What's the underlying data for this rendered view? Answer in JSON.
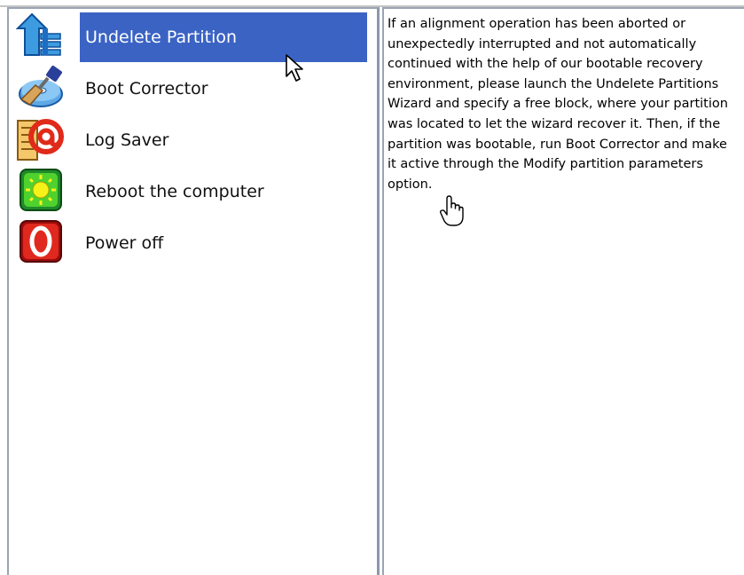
{
  "menu": {
    "items": [
      {
        "label": "Undelete Partition",
        "icon": "undelete-partition-icon",
        "selected": true
      },
      {
        "label": "Boot Corrector",
        "icon": "boot-corrector-icon",
        "selected": false
      },
      {
        "label": "Log Saver",
        "icon": "log-saver-icon",
        "selected": false
      },
      {
        "label": "Reboot the computer",
        "icon": "reboot-icon",
        "selected": false
      },
      {
        "label": "Power off",
        "icon": "power-off-icon",
        "selected": false
      }
    ]
  },
  "description": {
    "text": "If an alignment operation has been aborted or unexpectedly interrupted and not automatically continued with the help of our bootable recovery environment, please launch the Undelete Partitions Wizard and specify a free block, where your partition was located to let the wizard recover it. Then, if the partition was bootable, run Boot Corrector and make it active through the Modify partition parameters option."
  },
  "colors": {
    "selection": "#3a63c4",
    "pane_border": "#9aa4b4"
  }
}
